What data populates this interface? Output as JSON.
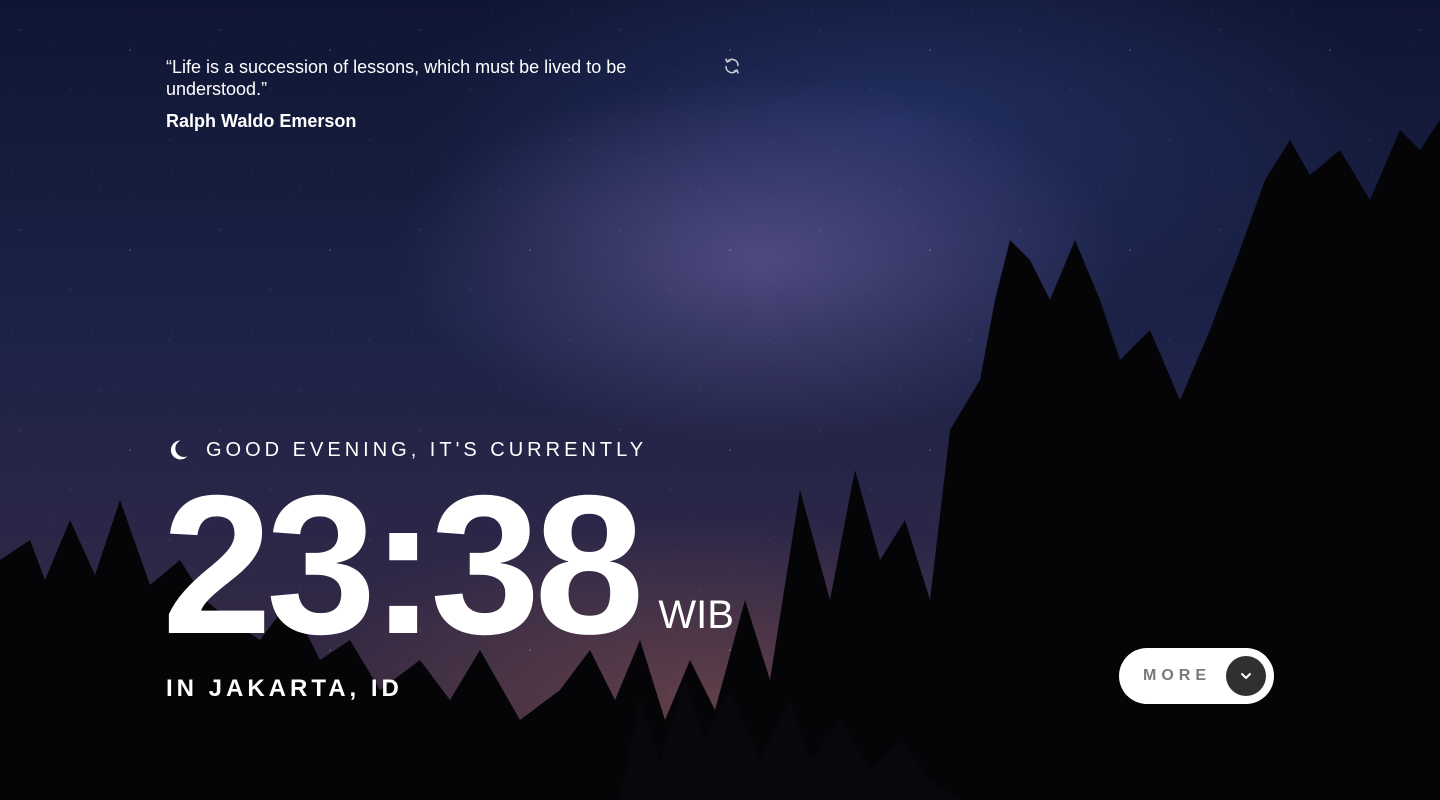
{
  "quote": {
    "text": "“Life is a succession of lessons, which must be lived to be understood.”",
    "author": "Ralph Waldo Emerson",
    "refresh_icon": "refresh-icon"
  },
  "greeting": {
    "icon": "moon-icon",
    "text": "GOOD EVENING, IT'S CURRENTLY"
  },
  "clock": {
    "time": "23:38",
    "zone": "WIB"
  },
  "location": {
    "text": "IN JAKARTA, ID"
  },
  "more_button": {
    "label": "MORE",
    "icon": "chevron-down-icon"
  },
  "colors": {
    "text": "#ffffff",
    "button_bg": "#ffffff",
    "button_label": "#7a7a7a",
    "chevron_bg": "#303030"
  }
}
